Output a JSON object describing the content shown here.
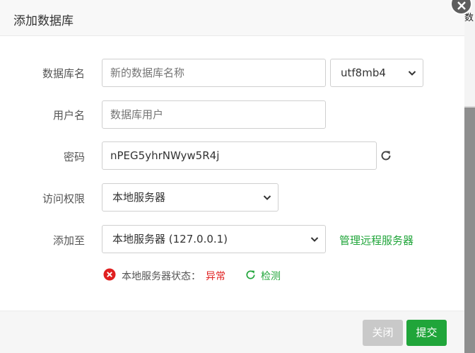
{
  "dialog": {
    "title": "添加数据库",
    "close_icon": "close-icon"
  },
  "background": {
    "partial_text": "数"
  },
  "form": {
    "db_name": {
      "label": "数据库名",
      "placeholder": "新的数据库名称",
      "value": ""
    },
    "charset": {
      "selected": "utf8mb4"
    },
    "username": {
      "label": "用户名",
      "placeholder": "数据库用户",
      "value": ""
    },
    "password": {
      "label": "密码",
      "value": "nPEG5yhrNWyw5R4j",
      "refresh_icon": "refresh-icon"
    },
    "access": {
      "label": "访问权限",
      "selected": "本地服务器"
    },
    "add_to": {
      "label": "添加至",
      "selected": "本地服务器 (127.0.0.1)",
      "manage_link": "管理远程服务器"
    },
    "status": {
      "label": "本地服务器状态：",
      "value": "异常",
      "check_label": "检测",
      "error_icon": "error-icon",
      "check_icon": "refresh-icon"
    }
  },
  "footer": {
    "close_label": "关闭",
    "submit_label": "提交"
  },
  "colors": {
    "accent": "#20a53a",
    "error": "#e02020",
    "disabled_button": "#c9c9c9"
  }
}
